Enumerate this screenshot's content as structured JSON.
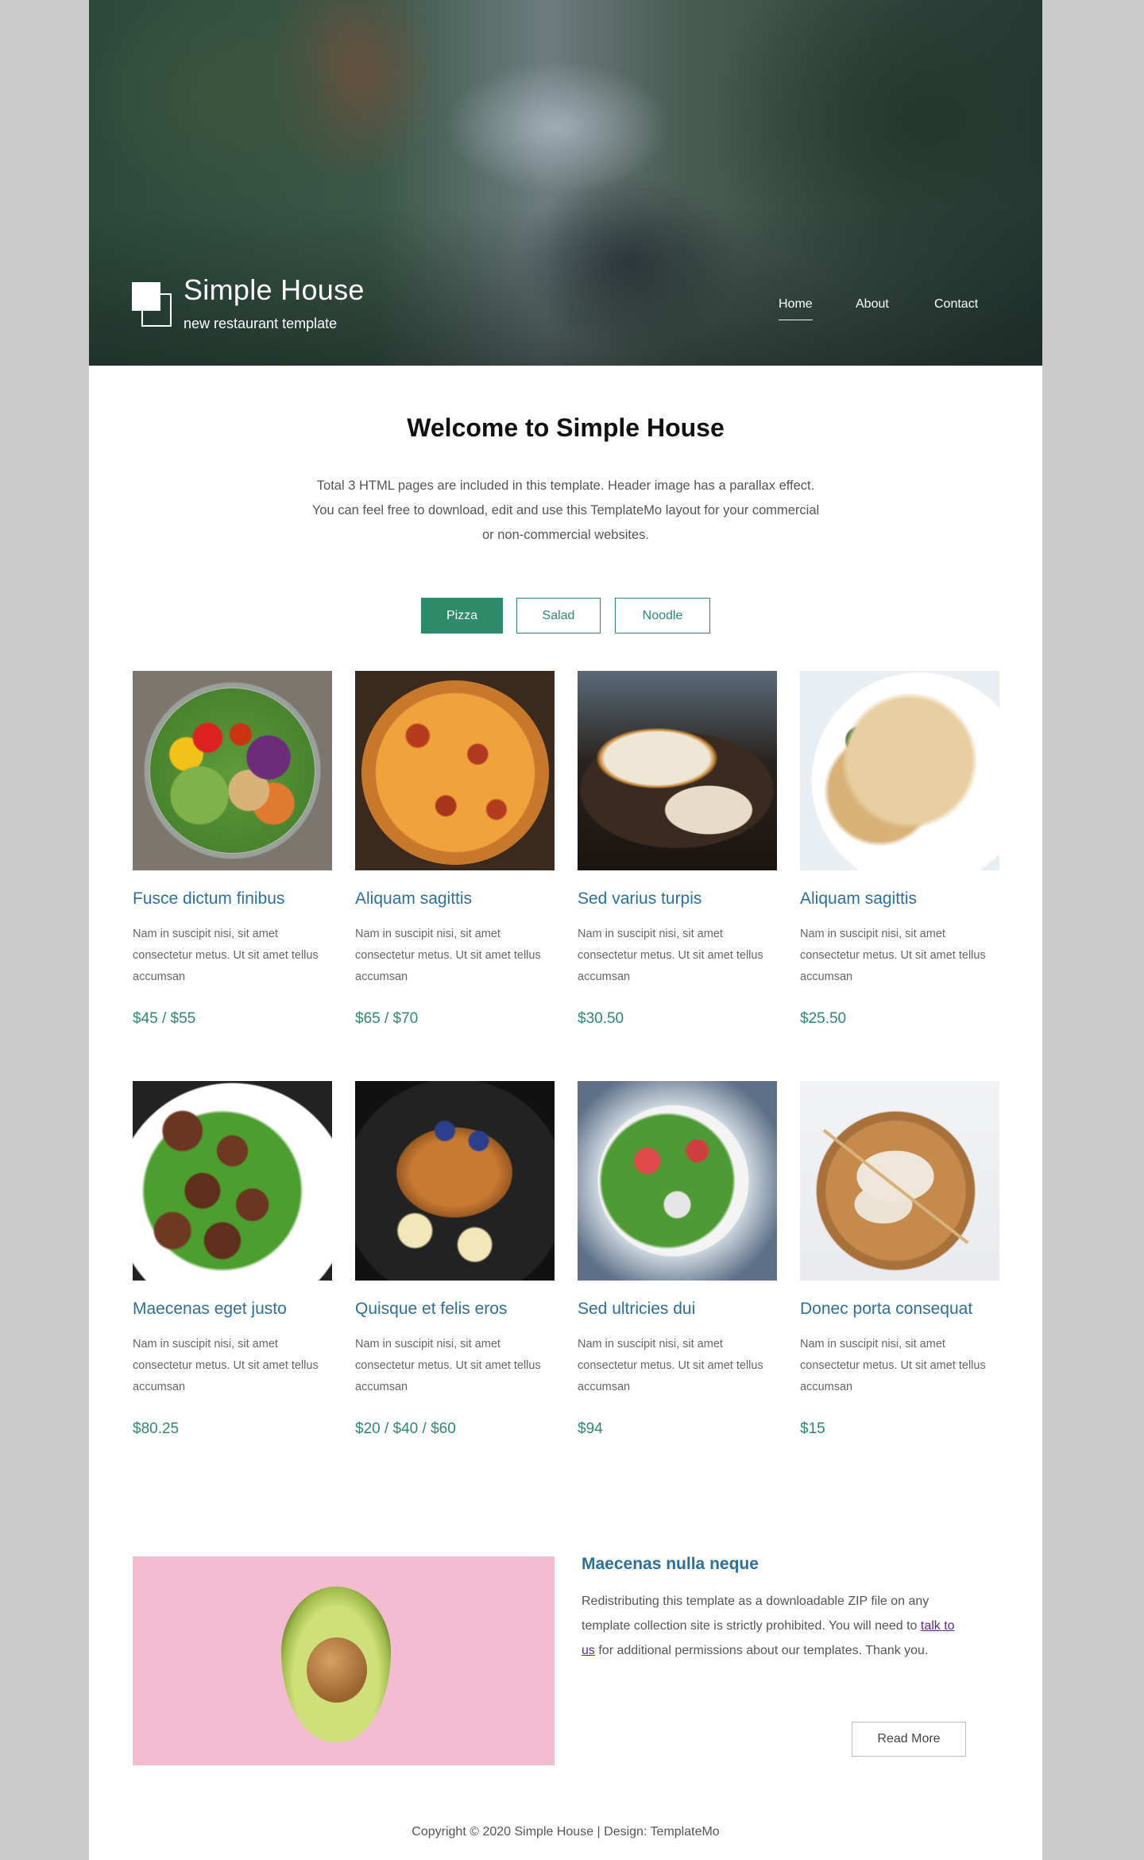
{
  "header": {
    "site_title": "Simple House",
    "tagline": "new restaurant template",
    "nav": [
      {
        "label": "Home",
        "active": true
      },
      {
        "label": "About",
        "active": false
      },
      {
        "label": "Contact",
        "active": false
      }
    ]
  },
  "intro": {
    "title": "Welcome to Simple House",
    "text": "Total 3 HTML pages are included in this template. Header image has a parallax effect. You can feel free to download, edit and use this TemplateMo layout for your commercial or non-commercial websites."
  },
  "tabs": [
    {
      "label": "Pizza",
      "active": true
    },
    {
      "label": "Salad",
      "active": false
    },
    {
      "label": "Noodle",
      "active": false
    }
  ],
  "items": [
    {
      "name": "Fusce dictum finibus",
      "desc": "Nam in suscipit nisi, sit amet consectetur metus. Ut sit amet tellus accumsan",
      "price": "$45 / $55",
      "image": "salad-bowl"
    },
    {
      "name": "Aliquam sagittis",
      "desc": "Nam in suscipit nisi, sit amet consectetur metus. Ut sit amet tellus accumsan",
      "price": "$65 / $70",
      "image": "pizza"
    },
    {
      "name": "Sed varius turpis",
      "desc": "Nam in suscipit nisi, sit amet consectetur metus. Ut sit amet tellus accumsan",
      "price": "$30.50",
      "image": "grilled-fish"
    },
    {
      "name": "Aliquam sagittis",
      "desc": "Nam in suscipit nisi, sit amet consectetur metus. Ut sit amet tellus accumsan",
      "price": "$25.50",
      "image": "pasta"
    },
    {
      "name": "Maecenas eget justo",
      "desc": "Nam in suscipit nisi, sit amet consectetur metus. Ut sit amet tellus accumsan",
      "price": "$80.25",
      "image": "meatballs"
    },
    {
      "name": "Quisque et felis eros",
      "desc": "Nam in suscipit nisi, sit amet consectetur metus. Ut sit amet tellus accumsan",
      "price": "$20 / $40 / $60",
      "image": "french-toast"
    },
    {
      "name": "Sed ultricies dui",
      "desc": "Nam in suscipit nisi, sit amet consectetur metus. Ut sit amet tellus accumsan",
      "price": "$94",
      "image": "fresh-salad"
    },
    {
      "name": "Donec porta consequat",
      "desc": "Nam in suscipit nisi, sit amet consectetur metus. Ut sit amet tellus accumsan",
      "price": "$15",
      "image": "dumplings"
    }
  ],
  "feature": {
    "title": "Maecenas nulla neque",
    "text_before": "Redistributing this template as a downloadable ZIP file on any template collection site is strictly prohibited. You will need to ",
    "link": "talk to us",
    "text_after": " for additional permissions about our templates. Thank you.",
    "button": "Read More"
  },
  "footer": {
    "copyright": "Copyright © 2020 Simple House | Design: TemplateMo"
  },
  "colors": {
    "accent": "#2e8b6a",
    "title_blue": "#2b6fa0",
    "page_bg": "#cccccc"
  }
}
